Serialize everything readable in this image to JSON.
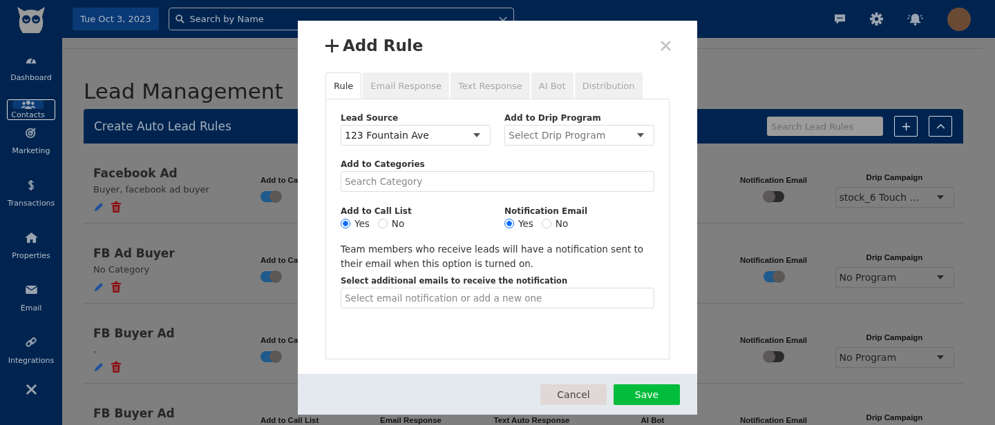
{
  "topbar": {
    "date": "Tue Oct 3, 2023",
    "search": {
      "placeholder": "Search by Name"
    }
  },
  "sidebar": {
    "items": [
      {
        "label": "Dashboard",
        "selected": false
      },
      {
        "label": "Contacts",
        "selected": true
      },
      {
        "label": "Marketing",
        "selected": false
      },
      {
        "label": "Transactions",
        "selected": false
      },
      {
        "label": "Properties",
        "selected": false
      },
      {
        "label": "Email",
        "selected": false
      },
      {
        "label": "Integrations",
        "selected": false
      }
    ]
  },
  "page": {
    "title": "Lead Management",
    "panel": {
      "title": "Create Auto Lead Rules",
      "search": {
        "placeholder": "Search Lead Rules"
      }
    }
  },
  "rules": [
    {
      "name": "Facebook Ad",
      "categories": "Buyer, facebook ad buyer",
      "call_list": {
        "label": "Add to Ca",
        "on": true
      },
      "notification": {
        "label": "Notification Email",
        "on": false
      },
      "drip": {
        "label": "Drip Campaign",
        "value": "stock_6 Touch ..."
      }
    },
    {
      "name": "FB Ad Buyer",
      "categories": "No Category",
      "call_list": {
        "label": "Add to Ca",
        "on": true
      },
      "notification": {
        "label": "Notification Email",
        "on": true
      },
      "drip": {
        "label": "Drip Campaign",
        "value": "No Program"
      }
    },
    {
      "name": "FB Buyer Ad",
      "categories": ",",
      "call_list": {
        "label": "Add to Ca",
        "on": true
      },
      "notification": {
        "label": "Notification Email",
        "on": false
      },
      "drip": {
        "label": "Drip Campaign",
        "value": "No Program"
      }
    },
    {
      "name": "FB Buyer Ad",
      "call_list": {
        "label": "Add to Call List"
      },
      "email_response": {
        "label": "Email Response"
      },
      "text_response": {
        "label": "Text Auto Response"
      },
      "ai_bot": {
        "label": "AI Bot"
      },
      "notification": {
        "label": "Notification Email"
      },
      "drip": {
        "label": "Drip Campaign"
      }
    }
  ],
  "modal": {
    "title": "Add Rule",
    "tabs": [
      {
        "label": "Rule",
        "selected": true
      },
      {
        "label": "Email Response",
        "selected": false
      },
      {
        "label": "Text Response",
        "selected": false
      },
      {
        "label": "AI Bot",
        "selected": false
      },
      {
        "label": "Distribution",
        "selected": false
      }
    ],
    "lead_source": {
      "label": "Lead Source",
      "value": "123 Fountain Ave"
    },
    "drip_program": {
      "label": "Add to Drip Program",
      "placeholder": "Select Drip Program"
    },
    "categories": {
      "label": "Add to Categories",
      "placeholder": "Search Category"
    },
    "radio_groups": [
      {
        "label": "Add to Call List",
        "options": [
          {
            "label": "Yes",
            "selected": true
          },
          {
            "label": "No",
            "selected": false
          }
        ]
      },
      {
        "label": "Notification Email",
        "options": [
          {
            "label": "Yes",
            "selected": true
          },
          {
            "label": "No",
            "selected": false
          }
        ]
      }
    ],
    "note": "Team members who receive leads will have a notification sent to their email when this option is turned on.",
    "emails": {
      "label": "Select additional emails to receive the notification",
      "placeholder": "Select email notification or add a new one"
    },
    "buttons": [
      {
        "label": "Cancel",
        "kind": "secondary"
      },
      {
        "label": "Save",
        "kind": "primary"
      }
    ]
  }
}
